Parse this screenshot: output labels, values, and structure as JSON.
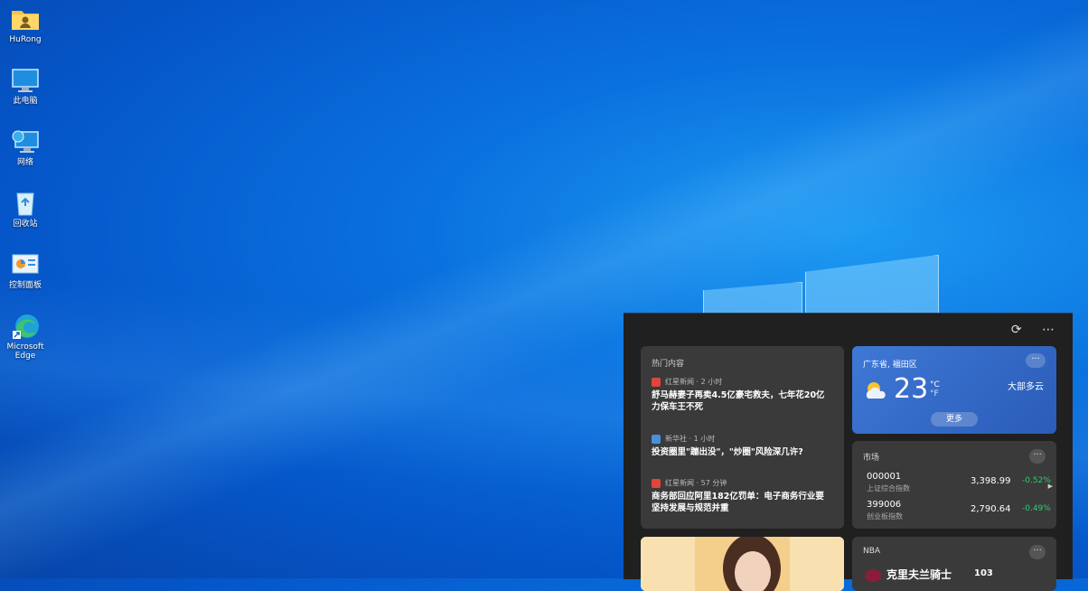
{
  "desktop_icons": [
    {
      "label": "HuRong",
      "icon": "folder-user-icon"
    },
    {
      "label": "此电脑",
      "icon": "computer-icon"
    },
    {
      "label": "网络",
      "icon": "network-icon"
    },
    {
      "label": "回收站",
      "icon": "recycle-bin-icon"
    },
    {
      "label": "控制面板",
      "icon": "control-panel-icon"
    },
    {
      "label": "Microsoft Edge",
      "icon": "edge-icon"
    }
  ],
  "widgets": {
    "toolbar": {
      "refresh_icon": "refresh-icon",
      "more_icon": "more-icon"
    },
    "news": {
      "header": "热门内容",
      "items": [
        {
          "source": "红星新闻 · 2 小时",
          "title": "舒马赫妻子再卖4.5亿豪宅救夫，七年花20亿力保车王不死",
          "logo_color": "#e0443a"
        },
        {
          "source": "新华社 · 1 小时",
          "title": "投资圈里\"蹦出没\"，\"炒圈\"风险深几许?",
          "logo_color": "#4a90d9"
        },
        {
          "source": "红星新闻 · 57 分钟",
          "title": "商务部回应阿里182亿罚单：电子商务行业要坚持发展与规范并重",
          "logo_color": "#e0443a"
        }
      ]
    },
    "weather": {
      "location": "广东省, 福田区",
      "temperature": "23",
      "unit_c": "°C",
      "unit_f": "°F",
      "condition": "大部多云",
      "more_button": "更多",
      "menu": "···"
    },
    "market": {
      "header": "市场",
      "menu": "···",
      "rows": [
        {
          "code": "000001",
          "name": "上证综合指数",
          "value": "3,398.99",
          "change": "-0.52%"
        },
        {
          "code": "399006",
          "name": "创业板指数",
          "value": "2,790.64",
          "change": "-0.49%"
        }
      ]
    },
    "nba": {
      "header": "NBA",
      "menu": "···",
      "team": "克里夫兰骑士",
      "score": "103"
    }
  },
  "colors": {
    "accent": "#0a72df",
    "positive_change": "#2ecc71",
    "panel_bg": "#202020",
    "card_bg": "#3a3a3a"
  }
}
